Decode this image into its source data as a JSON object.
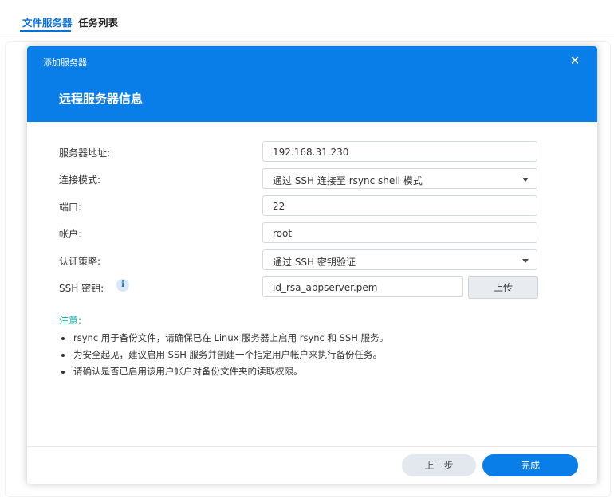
{
  "tabs": [
    {
      "label": "文件服务器",
      "active": true
    },
    {
      "label": "任务列表",
      "active": false
    }
  ],
  "dialog": {
    "window_title": "添加服务器",
    "close_symbol": "✕",
    "heading": "远程服务器信息",
    "header_color": "#0a7ee8",
    "fields": {
      "server_address": {
        "label": "服务器地址:",
        "value": "192.168.31.230"
      },
      "connection_mode": {
        "label": "连接模式:",
        "value": "通过 SSH 连接至 rsync shell 模式"
      },
      "port": {
        "label": "端口:",
        "value": "22"
      },
      "account": {
        "label": "帐户:",
        "value": "root"
      },
      "auth_policy": {
        "label": "认证策略:",
        "value": "通过 SSH 密钥验证"
      },
      "ssh_key": {
        "label": "SSH 密钥:",
        "value": "id_rsa_appserver.pem",
        "info_icon": "i",
        "upload_label": "上传"
      }
    },
    "notes": {
      "title": "注意:",
      "title_color": "#10a9a0",
      "items": [
        "rsync 用于备份文件，请确保已在 Linux 服务器上启用 rsync 和 SSH 服务。",
        "为安全起见，建议启用 SSH 服务并创建一个指定用户帐户来执行备份任务。",
        "请确认是否已启用该用户帐户对备份文件夹的读取权限。"
      ]
    },
    "buttons": {
      "prev": "上一步",
      "finish": "完成"
    }
  }
}
